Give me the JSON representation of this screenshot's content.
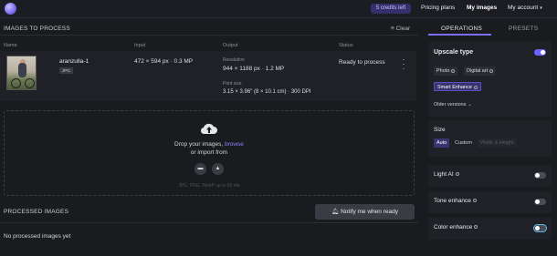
{
  "header": {
    "credits": "5 credits left",
    "nav": {
      "pricing": "Pricing plans",
      "my_images": "My images",
      "my_account": "My account"
    }
  },
  "process": {
    "title": "IMAGES TO PROCESS",
    "clear_label": "Clear",
    "columns": {
      "name": "Name",
      "input": "Input",
      "output": "Output",
      "status": "Status"
    },
    "file": {
      "name": "aranzulla-1",
      "type": "JPG",
      "input": "472 × 594 px · 0.3 MP",
      "resolution_label": "Resolution",
      "resolution": "944 × 1188 px · 1.2 MP",
      "print_label": "Print size",
      "print_size": "3.15 × 3.96\" (8 × 10.1 cm) · 300 DPI",
      "status": "Ready to process"
    },
    "dropzone": {
      "text": "Drop your images,",
      "browse": "browse",
      "import": "or import from",
      "hint": "JPG, PNG, WebP up to 50 mb"
    }
  },
  "processed": {
    "title": "PROCESSED IMAGES",
    "notify_label": "Notify me when ready",
    "empty_text": "No processed images yet"
  },
  "panel": {
    "tabs": {
      "operations": "OPERATIONS",
      "presets": "PRESETS"
    },
    "upscale": {
      "title": "Upscale type",
      "enabled": true,
      "options": [
        "Photo",
        "Digital art",
        "Smart Enhance"
      ],
      "selected": "Smart Enhance",
      "older_versions": "Older versions"
    },
    "size": {
      "title": "Size",
      "options": [
        "Auto",
        "Custom",
        "Width & Height"
      ],
      "selected": "Auto"
    },
    "light_ai": {
      "title": "Light AI",
      "enabled": false
    },
    "tone_enhance": {
      "title": "Tone enhance",
      "enabled": false
    },
    "color_enhance": {
      "title": "Color enhance",
      "enabled": false
    }
  },
  "colors": {
    "accent": "#7a70ff",
    "selected_chip": "#3b336f",
    "background": "#1a1b1f"
  }
}
